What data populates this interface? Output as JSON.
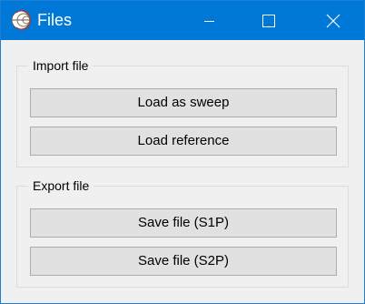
{
  "window": {
    "title": "Files",
    "accent_color": "#0078d7"
  },
  "import_group": {
    "legend": "Import file",
    "load_sweep_label": "Load as sweep",
    "load_reference_label": "Load reference"
  },
  "export_group": {
    "legend": "Export file",
    "save_s1p_label": "Save file (S1P)",
    "save_s2p_label": "Save file (S2P)"
  },
  "icons": {
    "app": "smith-chart-icon",
    "minimize": "minimize-icon",
    "maximize": "maximize-icon",
    "close": "close-icon"
  }
}
